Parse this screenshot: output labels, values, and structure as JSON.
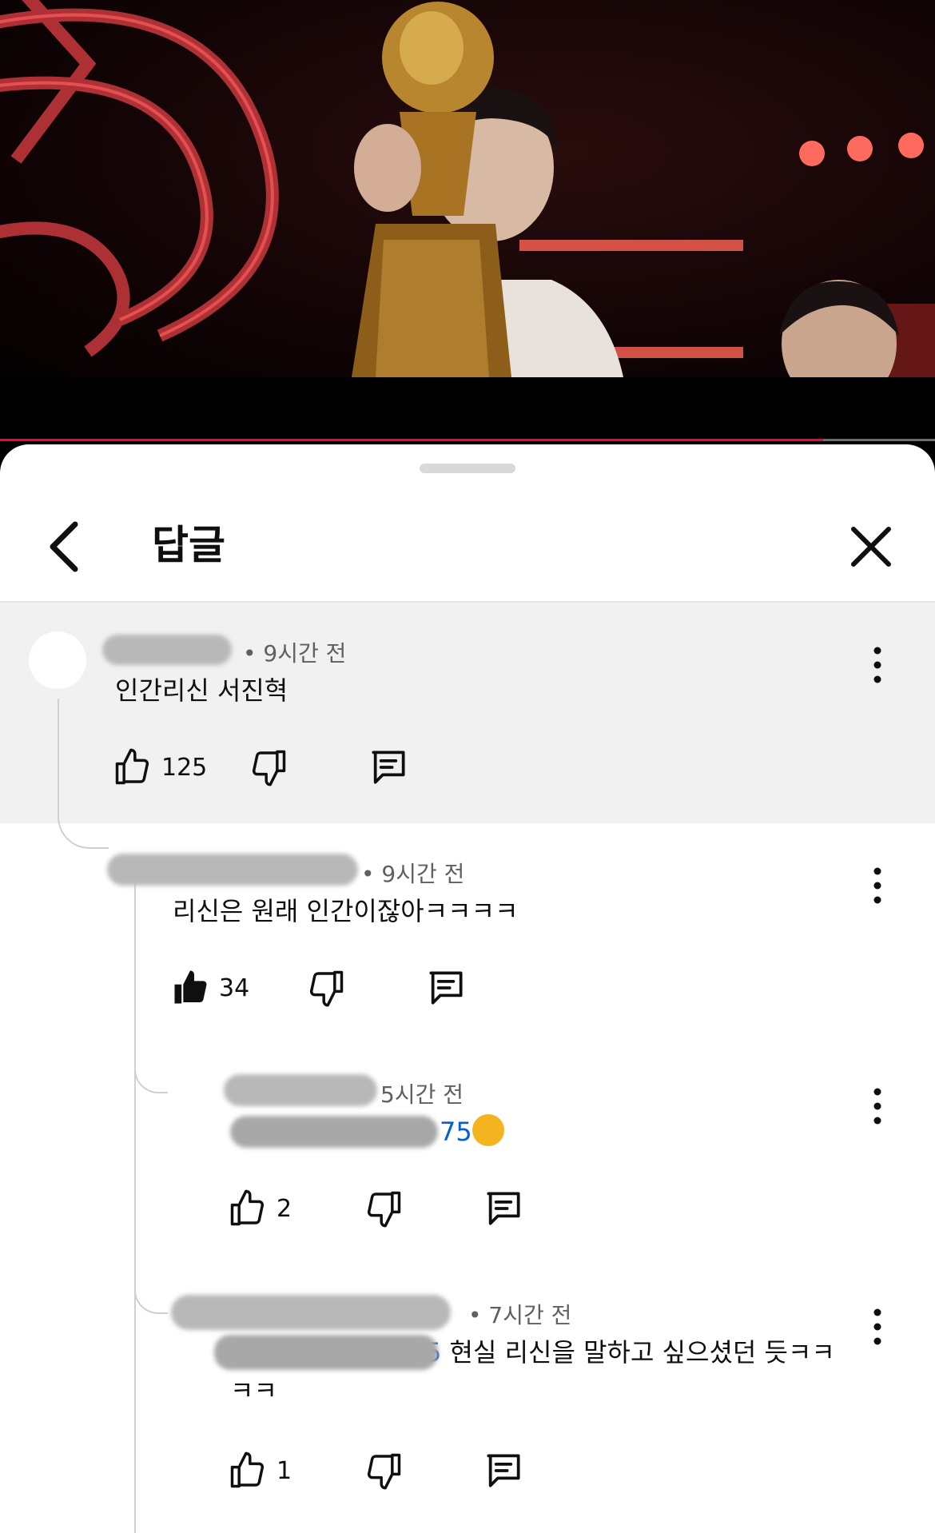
{
  "video": {
    "progress_percent": 88,
    "accent_color": "#ff0033"
  },
  "sheet": {
    "title": "답글",
    "back_icon": "chevron-left-icon",
    "close_icon": "close-icon"
  },
  "comments": [
    {
      "time": "• 9시간 전",
      "text": "인간리신 서진혁",
      "likes": "125",
      "liked": false
    },
    {
      "time": "• 9시간 전",
      "text": "리신은 원래 인간이잖아ㅋㅋㅋㅋ",
      "likes": "34",
      "liked": true
    },
    {
      "time": "5시간 전",
      "mention_tail": "75",
      "emoji": "shushing-face-emoji",
      "likes": "2",
      "liked": false
    },
    {
      "time": "• 7시간 전",
      "mention_tail": "5",
      "text": "현실 리신을 말하고 싶으셨던 듯ㅋㅋ",
      "text_cont": "ㅋㅋ",
      "likes": "1",
      "liked": false
    }
  ]
}
